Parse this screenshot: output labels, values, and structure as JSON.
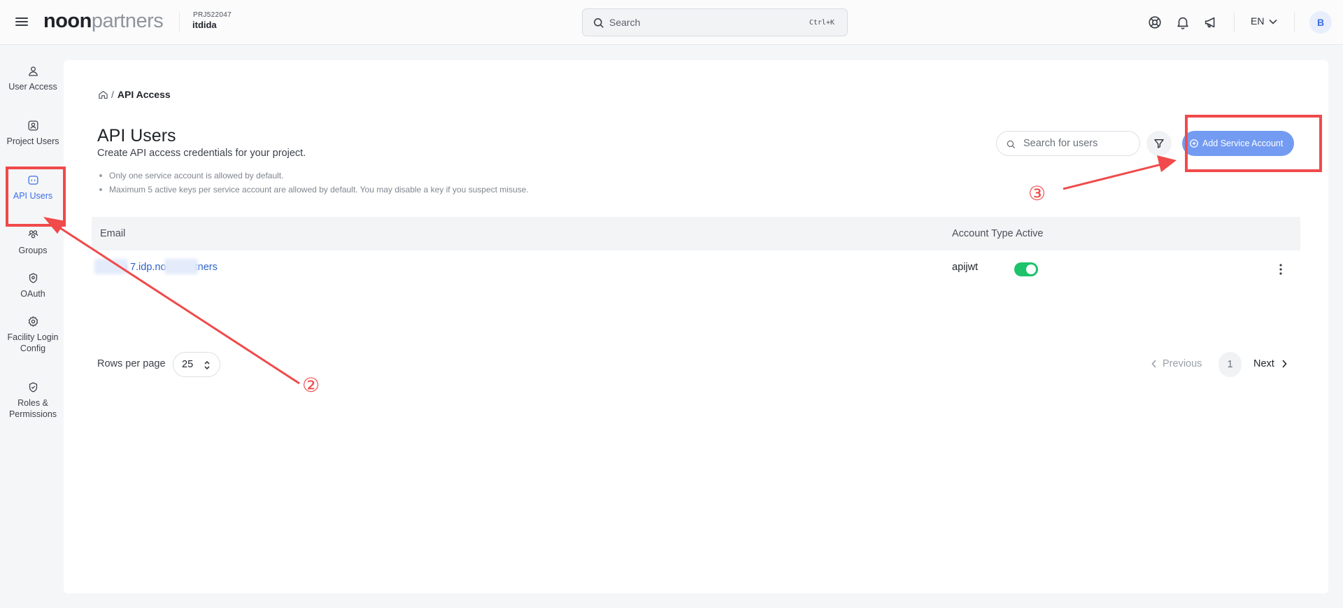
{
  "header": {
    "logo_bold": "noon",
    "logo_light": "partners",
    "project_code": "PRJ522047",
    "project_name": "itdida",
    "search_placeholder": "Search",
    "search_shortcut": "Ctrl+K",
    "language": "EN",
    "avatar_initial": "B"
  },
  "sidebar": {
    "items": [
      {
        "label": "User Access",
        "icon": "user-icon"
      },
      {
        "label": "Project Users",
        "icon": "project-user-icon"
      },
      {
        "label": "API Users",
        "icon": "api-icon",
        "active": true
      },
      {
        "label": "Groups",
        "icon": "groups-icon"
      },
      {
        "label": "OAuth",
        "icon": "oauth-icon"
      },
      {
        "label": "Facility Login Config",
        "icon": "facility-gear-icon"
      },
      {
        "label": "Roles & Permissions",
        "icon": "shield-check-icon"
      }
    ]
  },
  "breadcrumb": {
    "separator": "/",
    "current": "API Access"
  },
  "page": {
    "title": "API Users",
    "subtitle": "Create API access credentials for your project.",
    "notes": [
      "Only one service account is allowed by default.",
      "Maximum 5 active keys per service account are allowed by default. You may disable a key if you suspect misuse."
    ]
  },
  "toolbar": {
    "search_placeholder": "Search for users",
    "add_button_label": "Add Service Account"
  },
  "table": {
    "columns": [
      "Email",
      "Account Type",
      "Active"
    ],
    "rows": [
      {
        "email": "01@p 7.idp.noon.partners",
        "account_type": "apijwt",
        "active": true
      }
    ]
  },
  "pagination": {
    "rows_per_page_label": "Rows per page",
    "rows_per_page": "25",
    "previous_label": "Previous",
    "current_page": "1",
    "next_label": "Next"
  },
  "annotations": {
    "step_2": "②",
    "step_3": "③",
    "color": "#f04a4a"
  },
  "colors": {
    "accent": "#3b6ee8",
    "add_button": "#739bf2",
    "toggle_on": "#1ec36a",
    "link": "#2f62c9"
  }
}
